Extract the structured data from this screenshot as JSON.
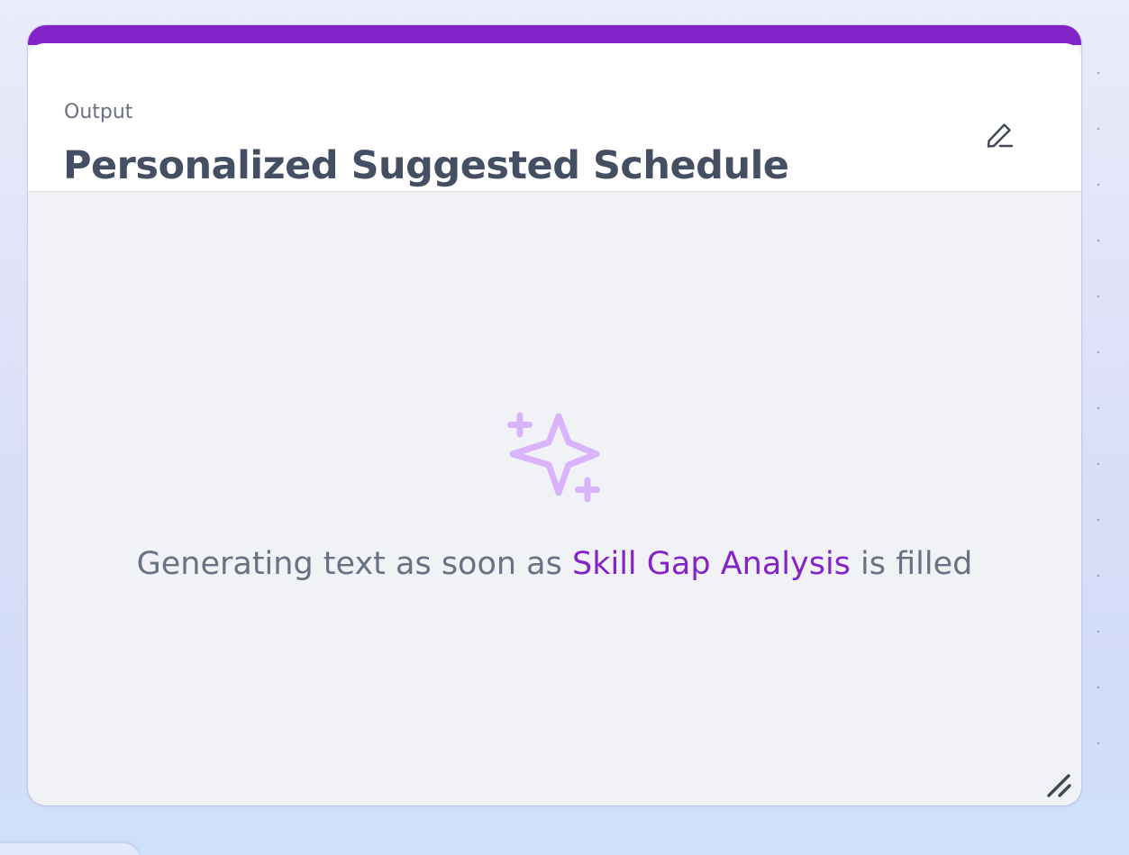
{
  "card": {
    "eyebrow": "Output",
    "title": "Personalized Suggested Schedule"
  },
  "empty_state": {
    "text_before": "Generating text as soon as ",
    "dependency_link": "Skill Gap Analysis",
    "text_after": " is filled"
  },
  "icons": {
    "edit": "pencil-icon",
    "placeholder": "sparkles-icon",
    "resize": "resize-handle-icon"
  },
  "colors": {
    "accent": "#8223c9",
    "sparkle": "#d9b3fb",
    "title": "#444f63",
    "muted_text": "#697184"
  }
}
